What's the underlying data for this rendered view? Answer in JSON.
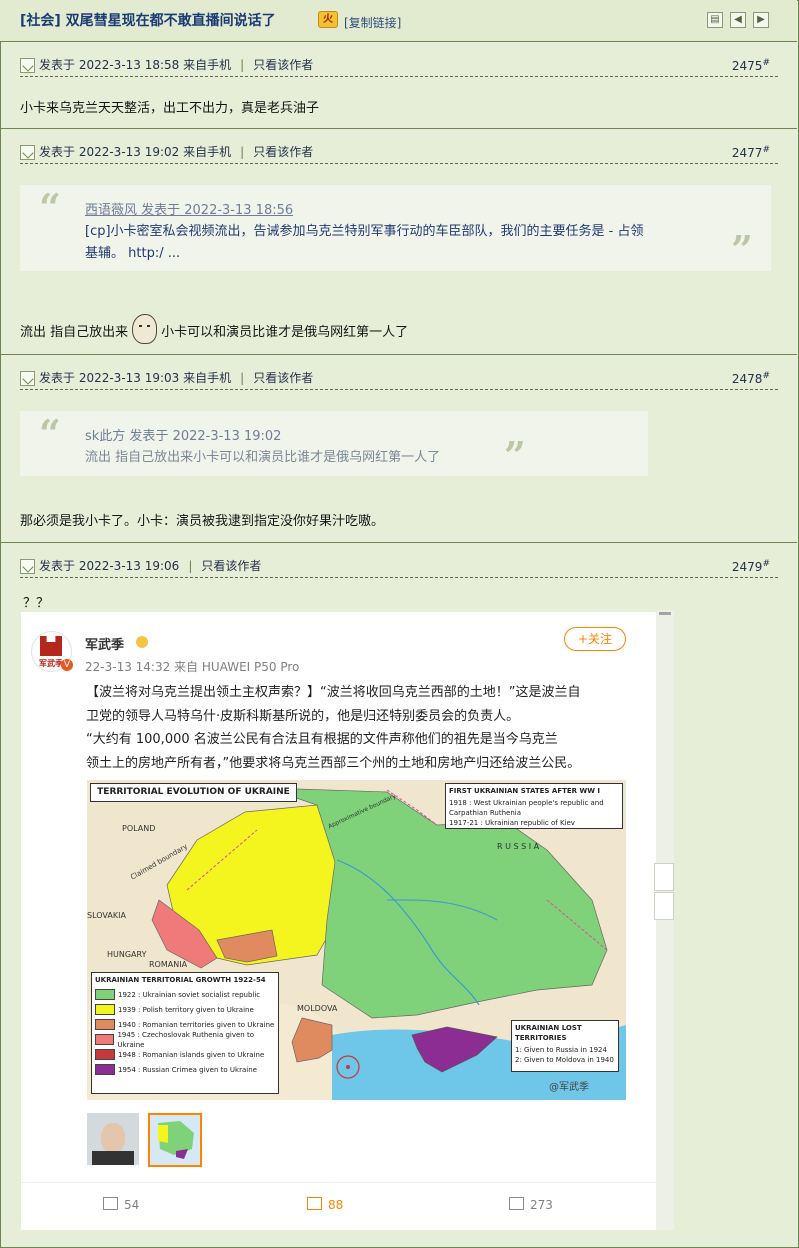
{
  "header": {
    "title": "[社会] 双尾彗星现在都不敢直播间说话了",
    "title_icon_text": "火",
    "copy_link": "[复制链接]"
  },
  "posts": [
    {
      "meta": "发表于 2022-3-13 18:58 来自手机",
      "only_author": "只看该作者",
      "floor": "2475",
      "floor_suffix": "#",
      "content": "小卡来乌克兰天天整活，出工不出力，真是老兵油子"
    },
    {
      "meta": "发表于 2022-3-13 19:02 来自手机",
      "only_author": "只看该作者",
      "floor": "2477",
      "floor_suffix": "#",
      "quote": {
        "author": "西语薇风 发表于 2022-3-13 18:56",
        "line1": "[cp]小卡密室私会视频流出，告诫参加乌克兰特别军事行动的车臣部队，我们的主要任务是 - 占领",
        "line2": "基辅。  http:/ ..."
      },
      "content_before": "流出 指自己放出来",
      "content_after": "小卡可以和演员比谁才是俄乌网红第一人了"
    },
    {
      "meta": "发表于 2022-3-13 19:03 来自手机",
      "only_author": "只看该作者",
      "floor": "2478",
      "floor_suffix": "#",
      "quote": {
        "author": "sk此方 发表于 2022-3-13 19:02",
        "line1": "流出 指自己放出来小卡可以和演员比谁才是俄乌网红第一人了"
      },
      "content": "那必须是我小卡了。小卡：演员被我逮到指定没你好果汁吃嗷。"
    },
    {
      "meta": "发表于 2022-3-13 19:06",
      "only_author": "只看该作者",
      "floor": "2479",
      "floor_suffix": "#",
      "content": "？？"
    }
  ],
  "weibo": {
    "name": "军武季",
    "avatar_text": "军武季",
    "date": "22-3-13 14:32  来自 HUAWEI P50 Pro",
    "follow": "+关注",
    "body_lines": [
      "【波兰将对乌克兰提出领土主权声索？】“波兰将收回乌克兰西部的土地！”这是波兰自",
      "卫党的领导人马特乌什·皮斯科斯基所说的，他是归还特别委员会的负责人。",
      "    “大约有 100,000 名波兰公民有合法且有根据的文件声称他们的祖先是当今乌克兰",
      "领土上的房地产所有者，”他要求将乌克兰西部三个州的土地和房地产归还给波兰公民。"
    ],
    "map": {
      "title": "TERRITORIAL EVOLUTION OF UKRAINE",
      "states_title": "FIRST UKRAINIAN STATES AFTER WW I",
      "states": [
        "1918 : West Ukrainian people's republic and Carpathian Ruthenia",
        "1917-21 : Ukrainian republic of Kiev"
      ],
      "growth_title": "UKRAINIAN TERRITORIAL GROWTH 1922-54",
      "growth": [
        {
          "label": "1922 : Ukrainian soviet socialist republic",
          "color": "#7fd17a"
        },
        {
          "label": "1939 : Polish territory given to Ukraine",
          "color": "#f4f41e"
        },
        {
          "label": "1940 : Romanian territories given to Ukraine",
          "color": "#e08a5f"
        },
        {
          "label": "1945 : Czechoslovak Ruthenia given to Ukraine",
          "color": "#f07a7a"
        },
        {
          "label": "1948 : Romanian islands given to Ukraine",
          "color": "#c5393a"
        },
        {
          "label": "1954 : Russian Crimea given to Ukraine",
          "color": "#8b2d92"
        }
      ],
      "lost_title": "UKRAINIAN LOST TERRITORIES",
      "lost": [
        "1: Given to Russia in 1924",
        "2: Given to Moldova in 1940"
      ],
      "labels": {
        "poland": "POLAND",
        "slovakia": "SLOVAKIA",
        "hungary": "HUNGARY",
        "romania": "ROMANIA",
        "moldova": "MOLDOVA",
        "russia": "R U S S I A",
        "claimed": "Claimed boundary",
        "approx": "Approximative boundary",
        "watermark": "@军武季"
      }
    },
    "footer": {
      "shares": "54",
      "comments": "88",
      "likes": "273"
    }
  },
  "colors": {
    "page_bg": "#e7eed8",
    "border": "#6d8454",
    "title_blue": "#1a3c75",
    "weibo_orange": "#ff8200"
  }
}
